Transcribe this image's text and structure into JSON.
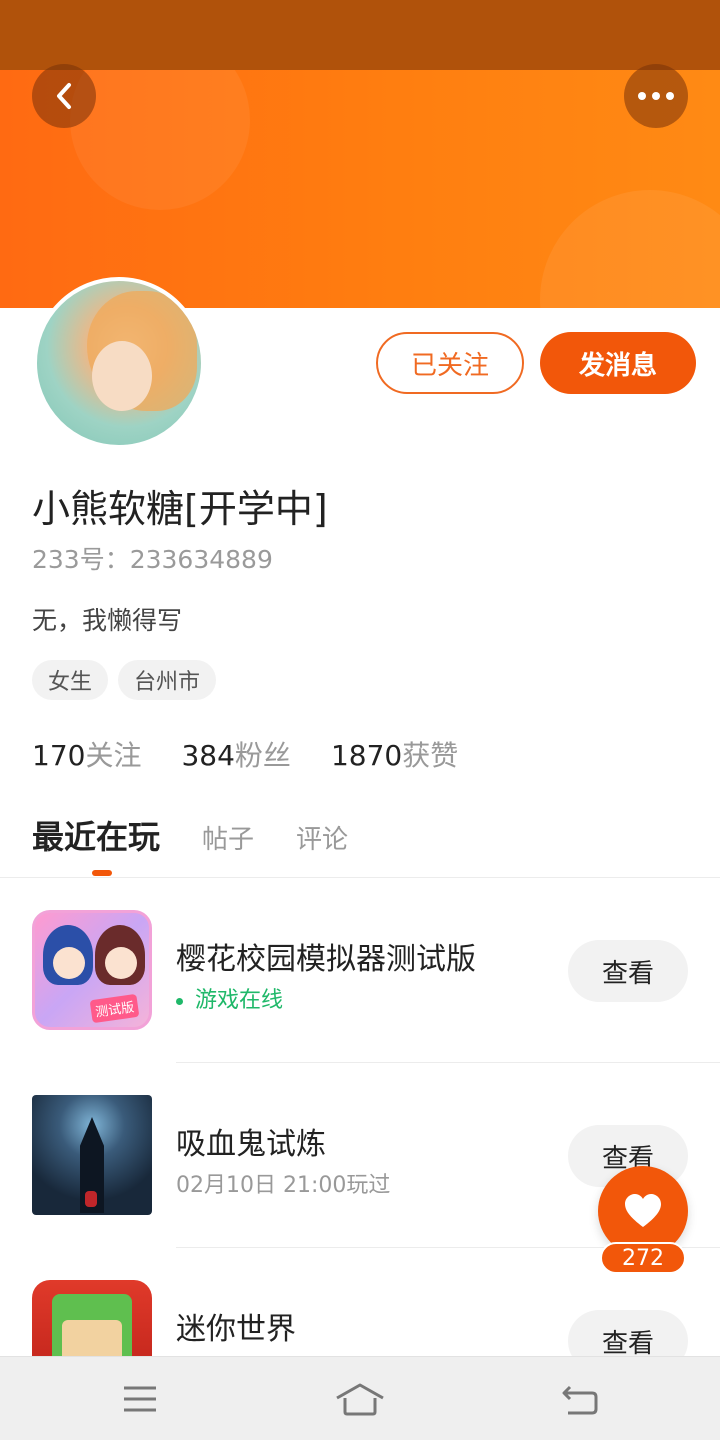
{
  "colors": {
    "accent": "#f2570a",
    "online_green": "#1fb869",
    "banner_orange": "#ff7e10"
  },
  "header": {
    "back_icon": "chevron-left-icon",
    "more_icon": "more-horizontal-icon"
  },
  "profile": {
    "follow_label": "已关注",
    "message_label": "发消息",
    "username": "小熊软糖[开学中]",
    "id_text": "233号：233634889",
    "bio": "无，我懒得写",
    "tags": [
      "女生",
      "台州市"
    ],
    "stats": [
      {
        "value": "170",
        "label": "关注"
      },
      {
        "value": "384",
        "label": "粉丝"
      },
      {
        "value": "1870",
        "label": "获赞"
      }
    ]
  },
  "tabs": [
    {
      "label": "最近在玩",
      "active": true
    },
    {
      "label": "帖子",
      "active": false
    },
    {
      "label": "评论",
      "active": false
    }
  ],
  "games": [
    {
      "title": "樱花校园模拟器测试版",
      "subtitle": "游戏在线",
      "online": true,
      "action": "查看",
      "icon_badge": "测试版"
    },
    {
      "title": "吸血鬼试炼",
      "subtitle": "02月10日 21:00玩过",
      "online": false,
      "action": "查看"
    },
    {
      "title": "迷你世界",
      "subtitle": "",
      "online": false,
      "action": "查看"
    }
  ],
  "like_fab": {
    "icon": "heart-icon",
    "count": "272"
  },
  "nav": {
    "menu_icon": "menu-icon",
    "home_icon": "home-icon",
    "back_icon": "back-arrow-icon"
  }
}
